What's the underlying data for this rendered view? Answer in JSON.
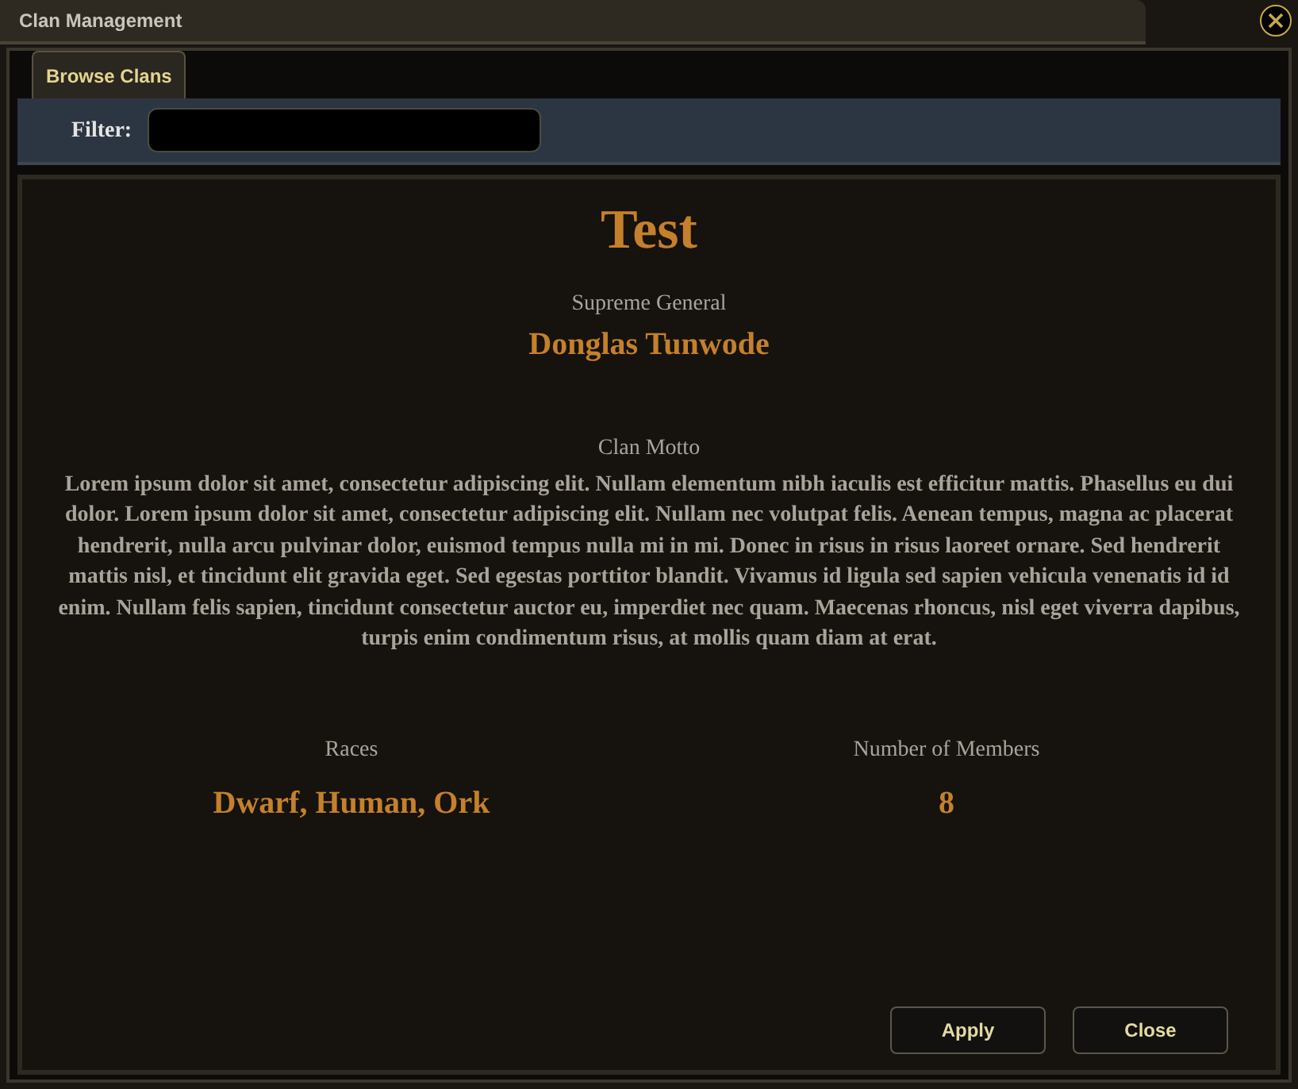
{
  "window": {
    "title": "Clan Management"
  },
  "tabs": [
    {
      "label": "Browse Clans",
      "selected": true
    }
  ],
  "filter": {
    "label": "Filter:"
  },
  "clan": {
    "name": "Test",
    "leader_title": "Supreme General",
    "leader_name": "Donglas Tunwode",
    "motto_label": "Clan Motto",
    "motto": "Lorem ipsum dolor sit amet, consectetur adipiscing elit. Nullam elementum nibh iaculis est efficitur mattis. Phasellus eu dui dolor. Lorem ipsum dolor sit amet, consectetur adipiscing elit. Nullam nec volutpat felis. Aenean tempus, magna ac placerat hendrerit, nulla arcu pulvinar dolor, euismod tempus nulla mi in mi. Donec in risus in risus laoreet ornare. Sed hendrerit mattis nisl, et tincidunt elit gravida eget. Sed egestas porttitor blandit. Vivamus id ligula sed sapien vehicula venenatis id id enim. Nullam felis sapien, tincidunt consectetur auctor eu, imperdiet nec quam. Maecenas rhoncus, nisl eget viverra dapibus, turpis enim condimentum risus, at mollis quam diam at erat.",
    "stats": [
      {
        "label": "Races",
        "value": "Dwarf, Human, Ork"
      },
      {
        "label": "Number of Members",
        "value": "8"
      }
    ]
  },
  "buttons": [
    "Apply",
    "Close"
  ]
}
